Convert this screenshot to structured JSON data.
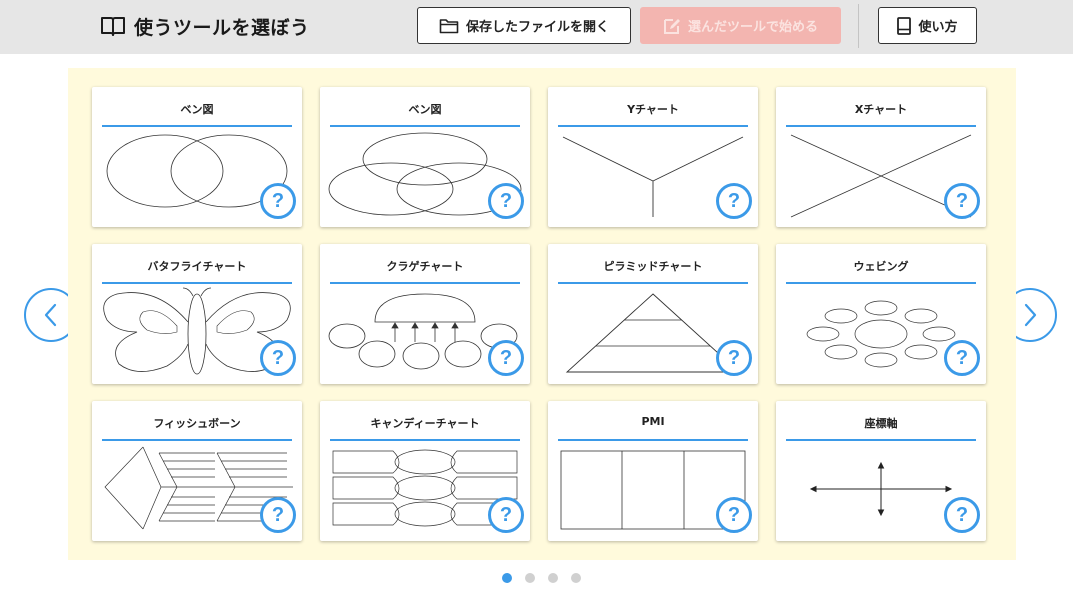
{
  "header": {
    "title": "使うツールを選ぼう",
    "open_file_label": "保存したファイルを開く",
    "start_label": "選んだツールで始める",
    "howto_label": "使い方"
  },
  "tools": [
    {
      "title": "ベン図"
    },
    {
      "title": "ベン図"
    },
    {
      "title": "Yチャート"
    },
    {
      "title": "Xチャート"
    },
    {
      "title": "バタフライチャート"
    },
    {
      "title": "クラゲチャート"
    },
    {
      "title": "ピラミッドチャート"
    },
    {
      "title": "ウェビング"
    },
    {
      "title": "フィッシュボーン"
    },
    {
      "title": "キャンディーチャート"
    },
    {
      "title": "PMI"
    },
    {
      "title": "座標軸"
    }
  ],
  "help_label": "?",
  "pagination": {
    "pages": 4,
    "current": 1
  },
  "colors": {
    "accent": "#3b9ae8",
    "panel_bg": "#fffadc",
    "header_bg": "#e6e6e6",
    "start_disabled": "#f3b5b0"
  },
  "icons": {
    "title": "book-icon",
    "open": "folder-icon",
    "start": "edit-icon",
    "howto": "manual-icon",
    "prev": "chevron-left-icon",
    "next": "chevron-right-icon",
    "help": "question-icon"
  }
}
